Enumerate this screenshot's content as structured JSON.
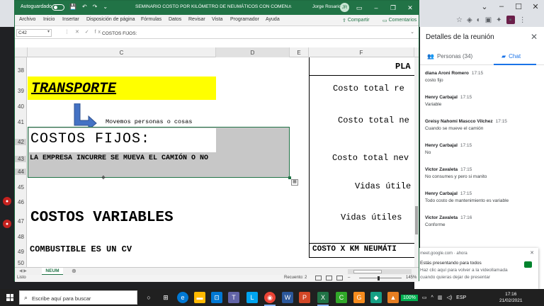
{
  "excel": {
    "autosave_label": "Autoguardado",
    "doc_title": "SEMINARIO COSTO POR KILÓMETRO DE NEUMÁTICOS CON COMEN...",
    "user_name": "Jorge Rosario",
    "user_initials": "JR",
    "menu": [
      "Archivo",
      "Inicio",
      "Insertar",
      "Disposición de página",
      "Fórmulas",
      "Datos",
      "Revisar",
      "Vista",
      "Programador",
      "Ayuda"
    ],
    "share_label": "Compartir",
    "comments_label": "Comentarios",
    "name_box": "C42",
    "formula_value": "COSTOS FIJOS:",
    "columns": [
      "C",
      "D",
      "E",
      "F"
    ],
    "rows": [
      "38",
      "39",
      "40",
      "41",
      "42",
      "43",
      "44",
      "45",
      "46",
      "47",
      "48",
      "49",
      "50"
    ],
    "cells": {
      "transporte": "TRANSPORTE",
      "movemos": "Movemos personas o cosas",
      "costos_fijos": "COSTOS FIJOS:",
      "empresa": "LA EMPRESA INCURRE SE MUEVA EL CAMIÓN O NO",
      "costos_variables": "COSTOS VARIABLES",
      "combustible": "COMBUSTIBLE ES UN CV",
      "pla": "PLA",
      "costo_total_1": "Costo total re",
      "costo_total_2": "Costo total ne",
      "costo_total_3": "Costo total nev",
      "vidas_1": "Vidas útile",
      "vidas_2": "Vidas útiles",
      "costo_km": "COSTO X KM NEUMÁTI"
    },
    "sheet_tab": "NEUM",
    "status_left": "Listo",
    "status_count": "Recuento: 2",
    "zoom": "145%"
  },
  "meet": {
    "panel_title": "Detalles de la reunión",
    "people_tab": "Personas (34)",
    "chat_tab": "Chat",
    "messages": [
      {
        "name": "diana Aroni Romero",
        "time": "17:15",
        "text": "costo fijo"
      },
      {
        "name": "Henry Carbajal",
        "time": "17:15",
        "text": "Variable"
      },
      {
        "name": "Greisy Nahomi Mascco Vilchez",
        "time": "17:15",
        "text": "Cuando se mueve el camión"
      },
      {
        "name": "Henry Carbajal",
        "time": "17:15",
        "text": "No"
      },
      {
        "name": "Victor Zavaleta",
        "time": "17:15",
        "text": "No consumes y pero si manito"
      },
      {
        "name": "Henry Carbajal",
        "time": "17:15",
        "text": "Todo costo de mantenimiento es variable"
      },
      {
        "name": "Victor Zavaleta",
        "time": "17:16",
        "text": "Conforme"
      }
    ],
    "notif_source": "meet.google.com · ahora",
    "notif_title": "Estás presentando para todos",
    "notif_line1": "Haz clic aquí para volver a la videollamada",
    "notif_line2": "cuando quieras dejar de presentar"
  },
  "taskbar": {
    "search_placeholder": "Escribe aquí para buscar",
    "battery": "100%",
    "lang": "ESP",
    "time": "17:16",
    "date": "21/02/2021"
  },
  "colors": {
    "excel_green": "#217346",
    "meet_blue": "#1a73e8",
    "highlight_yellow": "#ffff00"
  }
}
